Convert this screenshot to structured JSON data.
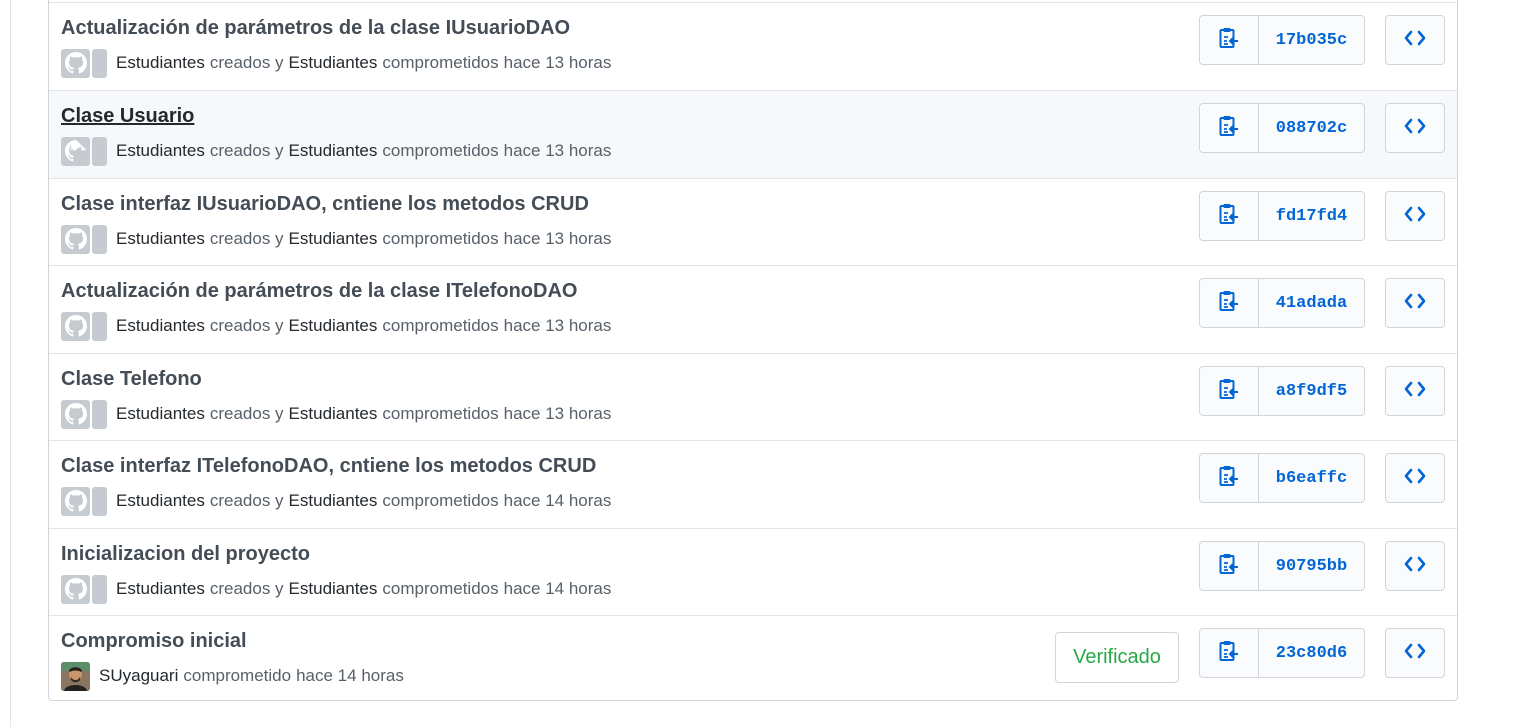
{
  "commits": [
    {
      "message": "Actualización de parámetros de la clase IUsuarioDAO",
      "author1": "Estudiantes",
      "text1": "creados y",
      "author2": "Estudiantes",
      "text2": "comprometidos",
      "time": "hace 13 horas",
      "sha": "17b035c"
    },
    {
      "message": "Clase Usuario",
      "author1": "Estudiantes",
      "text1": "creados y",
      "author2": "Estudiantes",
      "text2": "comprometidos",
      "time": "hace 13 horas",
      "sha": "088702c"
    },
    {
      "message": "Clase interfaz IUsuarioDAO, cntiene los metodos CRUD",
      "author1": "Estudiantes",
      "text1": "creados y",
      "author2": "Estudiantes",
      "text2": "comprometidos",
      "time": "hace 13 horas",
      "sha": "fd17fd4"
    },
    {
      "message": "Actualización de parámetros de la clase ITelefonoDAO",
      "author1": "Estudiantes",
      "text1": "creados y",
      "author2": "Estudiantes",
      "text2": "comprometidos",
      "time": "hace 13 horas",
      "sha": "41adada"
    },
    {
      "message": "Clase Telefono",
      "author1": "Estudiantes",
      "text1": "creados y",
      "author2": "Estudiantes",
      "text2": "comprometidos",
      "time": "hace 13 horas",
      "sha": "a8f9df5"
    },
    {
      "message": "Clase interfaz ITelefonoDAO, cntiene los metodos CRUD",
      "author1": "Estudiantes",
      "text1": "creados y",
      "author2": "Estudiantes",
      "text2": "comprometidos",
      "time": "hace 14 horas",
      "sha": "b6eaffc"
    },
    {
      "message": "Inicializacion del proyecto",
      "author1": "Estudiantes",
      "text1": "creados y",
      "author2": "Estudiantes",
      "text2": "comprometidos",
      "time": "hace 14 horas",
      "sha": "90795bb"
    },
    {
      "message": "Compromiso inicial",
      "author1": "SUyaguari",
      "text1": "comprometido",
      "time": "hace 14 horas",
      "sha": "23c80d6",
      "verified_label": "Verificado"
    }
  ],
  "icons": {
    "copy": "clipboard-copy-icon",
    "browse": "code-icon",
    "avatar": "github-octocat-icon"
  },
  "colors": {
    "link": "#0366d6",
    "verified": "#28a745",
    "hover_row": "#f6f8fa"
  }
}
